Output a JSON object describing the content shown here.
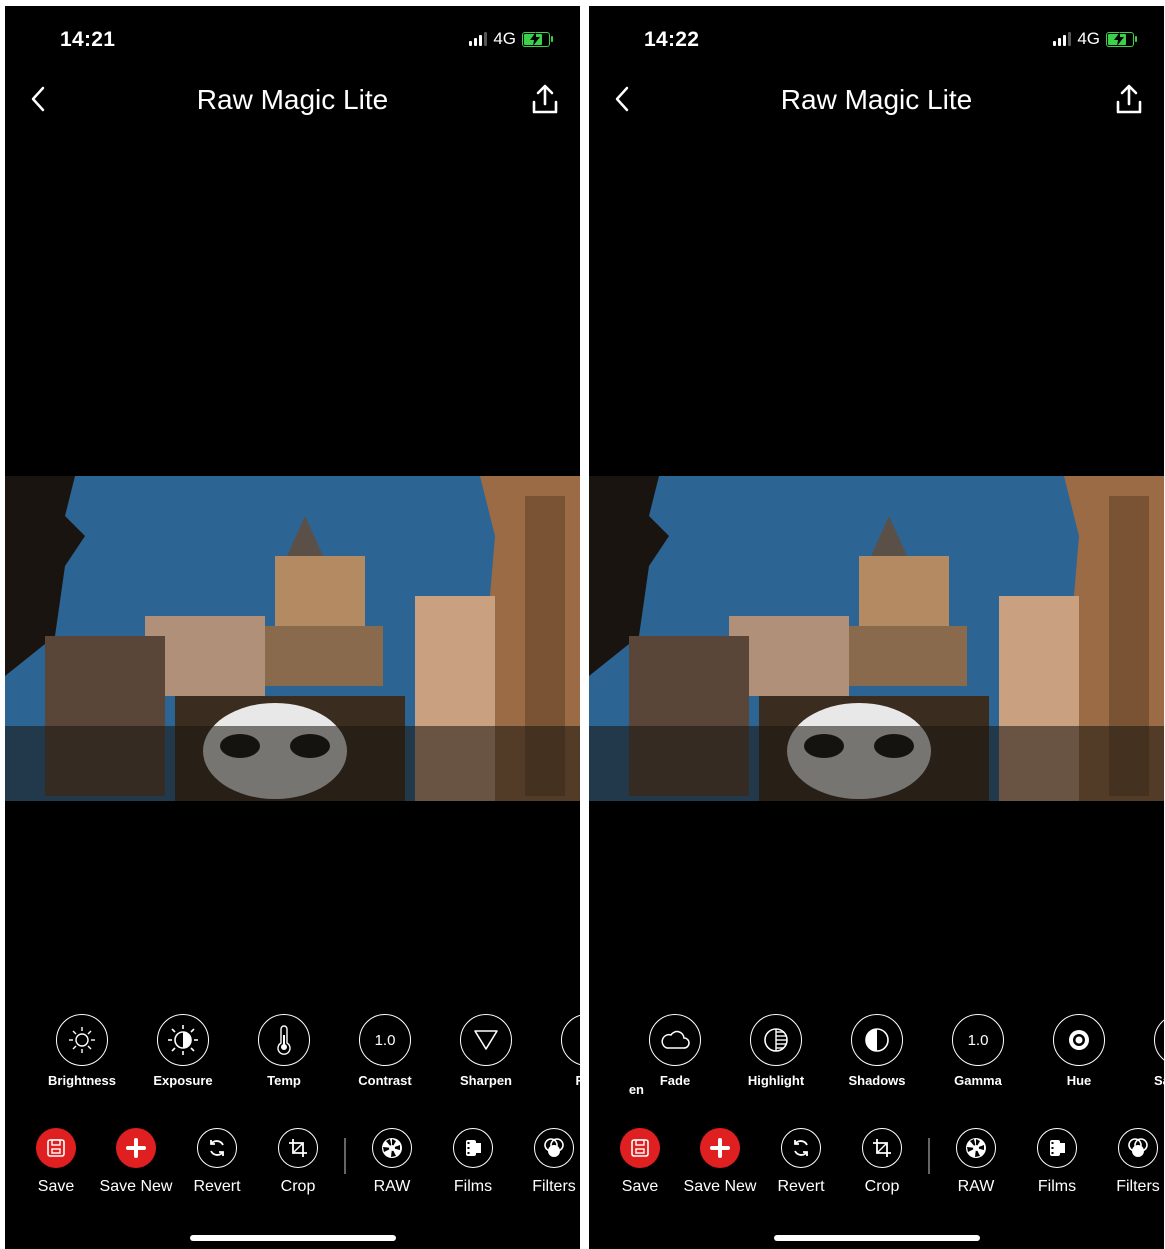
{
  "screens": [
    {
      "status": {
        "time": "14:21",
        "network": "4G"
      },
      "nav": {
        "title": "Raw Magic Lite"
      },
      "tools": [
        {
          "label": "Brightness",
          "icon": "sun-icon"
        },
        {
          "label": "Exposure",
          "icon": "exposure-icon"
        },
        {
          "label": "Temp",
          "icon": "thermometer-icon"
        },
        {
          "label": "Contrast",
          "icon": "value-icon",
          "value": "1.0"
        },
        {
          "label": "Sharpen",
          "icon": "triangle-icon"
        },
        {
          "label": "Fen",
          "icon": "partial-icon"
        }
      ],
      "actions": [
        {
          "label": "Save",
          "icon": "save-icon"
        },
        {
          "label": "Save New",
          "icon": "plus-icon"
        },
        {
          "label": "Revert",
          "icon": "revert-icon"
        },
        {
          "label": "Crop",
          "icon": "crop-icon"
        },
        {
          "label": "RAW",
          "icon": "aperture-icon"
        },
        {
          "label": "Films",
          "icon": "film-icon"
        },
        {
          "label": "Filters",
          "icon": "filters-icon"
        }
      ]
    },
    {
      "status": {
        "time": "14:22",
        "network": "4G"
      },
      "nav": {
        "title": "Raw Magic Lite"
      },
      "tools": [
        {
          "label": "en",
          "icon": "partial-icon"
        },
        {
          "label": "Fade",
          "icon": "cloud-icon"
        },
        {
          "label": "Highlight",
          "icon": "highlight-icon"
        },
        {
          "label": "Shadows",
          "icon": "shadows-icon"
        },
        {
          "label": "Gamma",
          "icon": "value-icon",
          "value": "1.0"
        },
        {
          "label": "Hue",
          "icon": "hue-icon"
        },
        {
          "label": "Sat",
          "icon": "partial-icon"
        }
      ],
      "actions": [
        {
          "label": "Save",
          "icon": "save-icon"
        },
        {
          "label": "Save New",
          "icon": "plus-icon"
        },
        {
          "label": "Revert",
          "icon": "revert-icon"
        },
        {
          "label": "Crop",
          "icon": "crop-icon"
        },
        {
          "label": "RAW",
          "icon": "aperture-icon"
        },
        {
          "label": "Films",
          "icon": "film-icon"
        },
        {
          "label": "Filters",
          "icon": "filters-icon"
        }
      ]
    }
  ],
  "colors": {
    "accent": "#e02020",
    "background": "#000000",
    "battery": "#3bd14a"
  }
}
